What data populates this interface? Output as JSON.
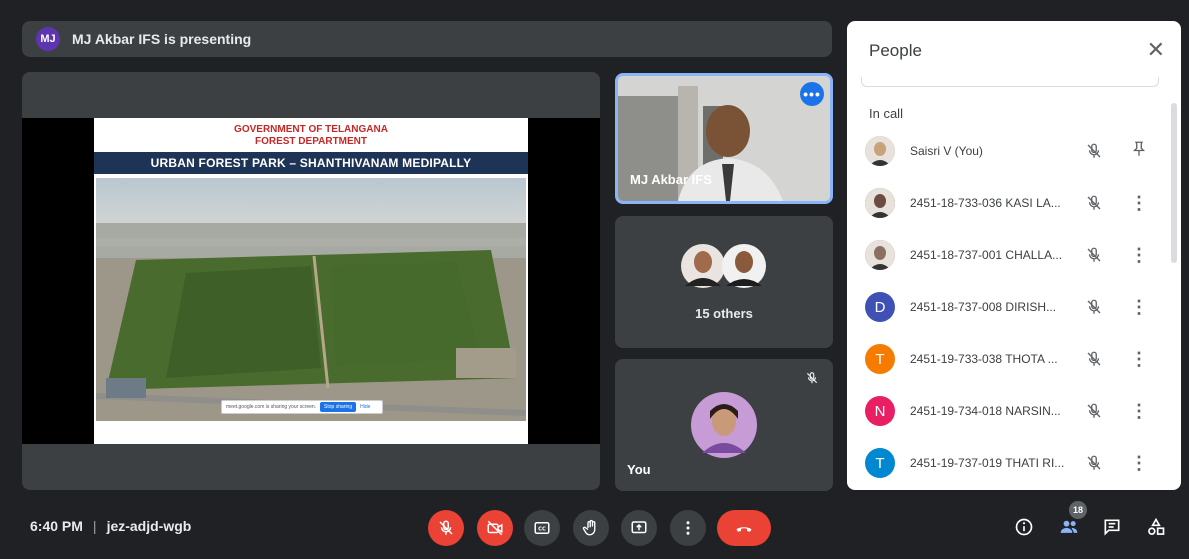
{
  "presenting": {
    "badge": "MJ",
    "text": "MJ Akbar IFS is presenting"
  },
  "slide": {
    "gov_line1": "GOVERNMENT OF TELANGANA",
    "gov_line2": "FOREST DEPARTMENT",
    "banner": "URBAN FOREST PARK – SHANTHIVANAM MEDIPALLY",
    "share_text": "meet.google.com is sharing your screen.",
    "stop_label": "Stop sharing",
    "hide_label": "Hide"
  },
  "tiles": {
    "speaker_name": "MJ Akbar IFS",
    "others_label": "15 others",
    "you_label": "You"
  },
  "people_panel": {
    "title": "People",
    "section": "In call",
    "participants": [
      {
        "name": "Saisri V (You)",
        "avatar": "photo",
        "color": "#c8a27a",
        "action": "pin-icon"
      },
      {
        "name": "2451-18-733-036 KASI LA...",
        "avatar": "photo",
        "color": "#6d4c41",
        "action": "more-vert-icon"
      },
      {
        "name": "2451-18-737-001 CHALLA...",
        "avatar": "photo",
        "color": "#8d6e63",
        "action": "more-vert-icon"
      },
      {
        "name": "2451-18-737-008 DIRISH...",
        "avatar": "D",
        "color": "#3f51b5",
        "action": "more-vert-icon"
      },
      {
        "name": "2451-19-733-038 THOTA ...",
        "avatar": "T",
        "color": "#f57c00",
        "action": "more-vert-icon"
      },
      {
        "name": "2451-19-734-018 NARSIN...",
        "avatar": "N",
        "color": "#e91e63",
        "action": "more-vert-icon"
      },
      {
        "name": "2451-19-737-019 THATI RI...",
        "avatar": "T",
        "color": "#0288d1",
        "action": "more-vert-icon"
      }
    ]
  },
  "bottom": {
    "time": "6:40 PM",
    "separator": "|",
    "meeting_code": "jez-adjd-wgb",
    "people_count": "18"
  },
  "colors": {
    "accent": "#1a73e8",
    "danger": "#ea4335",
    "bar": "#3c4043",
    "background": "#202124"
  }
}
